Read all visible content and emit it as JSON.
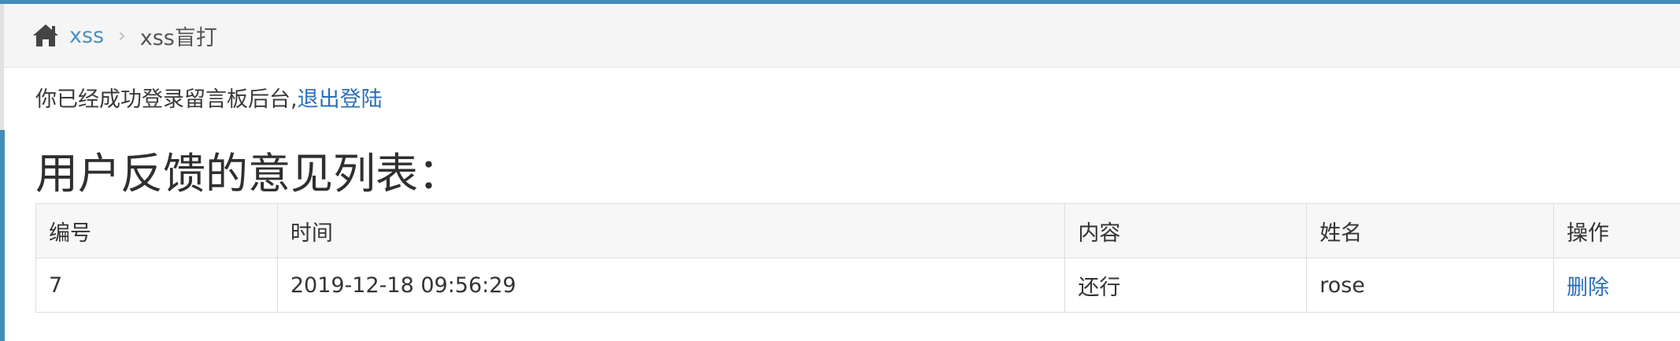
{
  "breadcrumb": {
    "home_icon": "home-icon",
    "items": [
      {
        "label": "xss",
        "link": true
      },
      {
        "label": "xss盲打",
        "link": false
      }
    ],
    "separator": "›"
  },
  "status": {
    "message": "你已经成功登录留言板后台,",
    "logout_label": "退出登陆"
  },
  "page_title": "用户反馈的意见列表：",
  "table": {
    "headers": [
      "编号",
      "时间",
      "内容",
      "姓名",
      "操作"
    ],
    "rows": [
      {
        "id": "7",
        "time": "2019-12-18 09:56:29",
        "content": "还行",
        "name": "rose",
        "action": "删除"
      }
    ]
  },
  "colors": {
    "accent": "#438eb9",
    "link": "#2a6fb8"
  }
}
